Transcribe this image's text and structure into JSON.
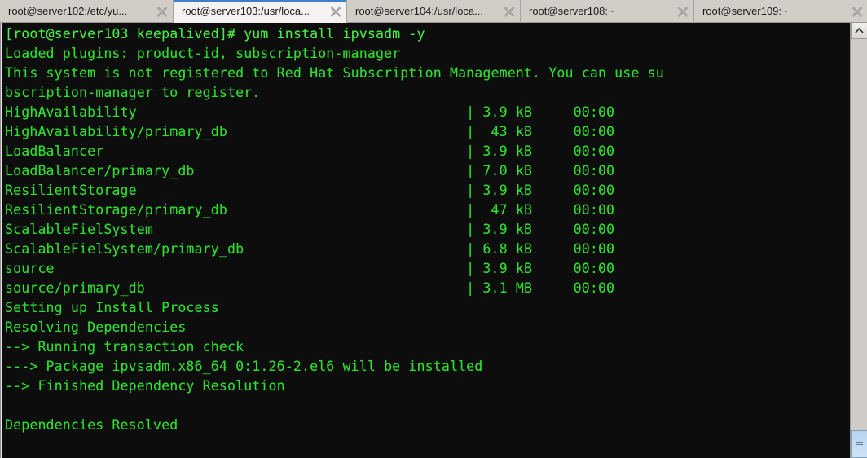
{
  "window": {
    "title": "root@server103:/usr/local",
    "background_color": "#0d0d0d",
    "text_color": "#2ee02e",
    "accent_color": "#3d7fc1"
  },
  "tabs": [
    {
      "label": "root@server102:/etc/yu...",
      "active": false,
      "close_icon": "close-icon"
    },
    {
      "label": "root@server103:/usr/loca...",
      "active": true,
      "close_icon": "close-icon"
    },
    {
      "label": "root@server104:/usr/loca...",
      "active": false,
      "close_icon": "close-icon"
    },
    {
      "label": "root@server108:~",
      "active": false,
      "close_icon": "close-icon"
    },
    {
      "label": "root@server109:~",
      "active": false,
      "close_icon": "close-icon"
    }
  ],
  "terminal": {
    "prompt": "[root@server103 keepalived]#",
    "command": "yum install ipvsadm -y",
    "lines": [
      {
        "text": "[root@server103 keepalived]# yum install ipvsadm -y",
        "bright": true
      },
      {
        "text": "Loaded plugins: product-id, subscription-manager",
        "bright": false
      },
      {
        "text": "This system is not registered to Red Hat Subscription Management. You can use su",
        "bright": false
      },
      {
        "text": "bscription-manager to register.",
        "bright": false
      },
      {
        "text": "HighAvailability                                        | 3.9 kB     00:00",
        "bright": false
      },
      {
        "text": "HighAvailability/primary_db                             |  43 kB     00:00",
        "bright": false
      },
      {
        "text": "LoadBalancer                                            | 3.9 kB     00:00",
        "bright": false
      },
      {
        "text": "LoadBalancer/primary_db                                 | 7.0 kB     00:00",
        "bright": false
      },
      {
        "text": "ResilientStorage                                        | 3.9 kB     00:00",
        "bright": false
      },
      {
        "text": "ResilientStorage/primary_db                             |  47 kB     00:00",
        "bright": false
      },
      {
        "text": "ScalableFielSystem                                      | 3.9 kB     00:00",
        "bright": false
      },
      {
        "text": "ScalableFielSystem/primary_db                           | 6.8 kB     00:00",
        "bright": false
      },
      {
        "text": "source                                                  | 3.9 kB     00:00",
        "bright": false
      },
      {
        "text": "source/primary_db                                       | 3.1 MB     00:00",
        "bright": false
      },
      {
        "text": "Setting up Install Process",
        "bright": false
      },
      {
        "text": "Resolving Dependencies",
        "bright": false
      },
      {
        "text": "--> Running transaction check",
        "bright": false
      },
      {
        "text": "---> Package ipvsadm.x86_64 0:1.26-2.el6 will be installed",
        "bright": false
      },
      {
        "text": "--> Finished Dependency Resolution",
        "bright": false
      },
      {
        "text": "",
        "bright": false
      },
      {
        "text": "Dependencies Resolved",
        "bright": false
      }
    ],
    "repositories": [
      {
        "name": "HighAvailability",
        "size": "3.9 kB",
        "time": "00:00"
      },
      {
        "name": "HighAvailability/primary_db",
        "size": "43 kB",
        "time": "00:00"
      },
      {
        "name": "LoadBalancer",
        "size": "3.9 kB",
        "time": "00:00"
      },
      {
        "name": "LoadBalancer/primary_db",
        "size": "7.0 kB",
        "time": "00:00"
      },
      {
        "name": "ResilientStorage",
        "size": "3.9 kB",
        "time": "00:00"
      },
      {
        "name": "ResilientStorage/primary_db",
        "size": "47 kB",
        "time": "00:00"
      },
      {
        "name": "ScalableFielSystem",
        "size": "3.9 kB",
        "time": "00:00"
      },
      {
        "name": "ScalableFielSystem/primary_db",
        "size": "6.8 kB",
        "time": "00:00"
      },
      {
        "name": "source",
        "size": "3.9 kB",
        "time": "00:00"
      },
      {
        "name": "source/primary_db",
        "size": "3.1 MB",
        "time": "00:00"
      }
    ],
    "package": {
      "name": "ipvsadm.x86_64",
      "version": "0:1.26-2.el6",
      "action": "will be installed"
    },
    "plugins": [
      "product-id",
      "subscription-manager"
    ],
    "status": "Dependencies Resolved"
  },
  "scrollbar": {
    "up_arrow_icon": "chevron-up-icon",
    "thumb_position": "bottom"
  }
}
